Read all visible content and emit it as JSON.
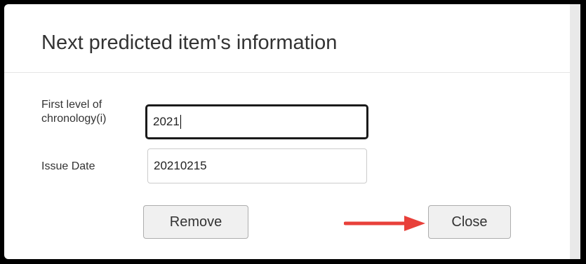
{
  "modal": {
    "title": "Next predicted item's information"
  },
  "form": {
    "chronology_label": "First level of chronology(i)",
    "chronology_value": "2021",
    "issue_date_label": "Issue Date",
    "issue_date_value": "20210215"
  },
  "buttons": {
    "remove_label": "Remove",
    "close_label": "Close"
  },
  "annotation": {
    "arrow_icon": "red-arrow-right",
    "arrow_color": "#e8403a"
  }
}
